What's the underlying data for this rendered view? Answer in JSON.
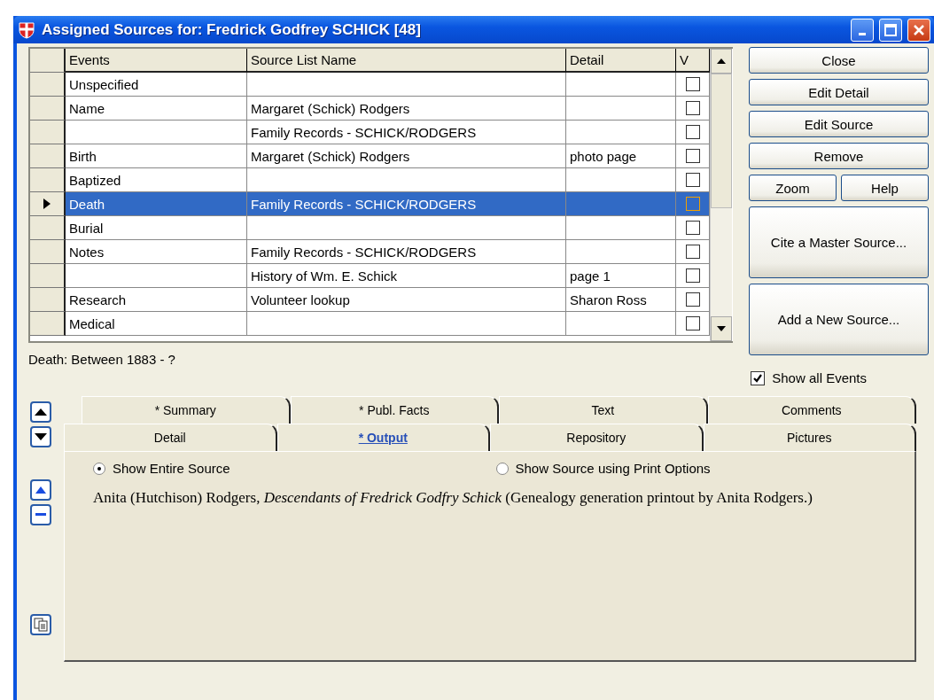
{
  "window": {
    "title": "Assigned Sources for: Fredrick Godfrey SCHICK [48]"
  },
  "table": {
    "columns": [
      "Events",
      "Source List Name",
      "Detail",
      "V"
    ],
    "rows": [
      {
        "event": "Unspecified",
        "selected": false,
        "checked": false
      },
      {
        "event": "Name",
        "source": "Margaret (Schick) Rodgers",
        "selected": false,
        "checked": false
      },
      {
        "source": "Family Records - SCHICK/RODGERS",
        "selected": false,
        "checked": false
      },
      {
        "event": "Birth",
        "source": "Margaret (Schick) Rodgers",
        "detail": "photo page",
        "selected": false,
        "checked": false
      },
      {
        "event": "Baptized",
        "selected": false,
        "checked": false
      },
      {
        "event": "Death",
        "source": "Family Records - SCHICK/RODGERS",
        "selected": true,
        "checked": false
      },
      {
        "event": "Burial",
        "selected": false,
        "checked": false
      },
      {
        "event": "Notes",
        "source": "Family Records - SCHICK/RODGERS",
        "selected": false,
        "checked": false
      },
      {
        "source": "History of Wm. E. Schick",
        "detail": "page 1",
        "selected": false,
        "checked": false
      },
      {
        "event": "Research",
        "source": "Volunteer lookup",
        "detail": "Sharon Ross",
        "selected": false,
        "checked": false
      },
      {
        "event": "Medical",
        "selected": false,
        "checked": false
      }
    ]
  },
  "buttons": [
    {
      "label": "Close",
      "kind": "wide"
    },
    {
      "label": "Edit Detail",
      "kind": "wide"
    },
    {
      "label": "Edit Source",
      "kind": "wide"
    },
    {
      "label": "Remove",
      "kind": "wide"
    },
    {
      "label": "Zoom",
      "kind": "pair"
    },
    {
      "label": "Help",
      "kind": "pair"
    },
    {
      "label": "Cite a Master Source...",
      "kind": "tall"
    },
    {
      "label": "Add a New Source...",
      "kind": "tall"
    }
  ],
  "status": "Death: Between 1883 - ?",
  "show_all_events": {
    "label": "Show all Events",
    "checked": true
  },
  "tabs_back": [
    {
      "label": "* Summary",
      "selected": false
    },
    {
      "label": "* Publ. Facts",
      "selected": false
    },
    {
      "label": "Text",
      "selected": false
    },
    {
      "label": "Comments",
      "selected": false
    }
  ],
  "tabs_front": [
    {
      "label": "Detail",
      "selected": false
    },
    {
      "label": "* Output",
      "selected": true
    },
    {
      "label": "Repository",
      "selected": false
    },
    {
      "label": "Pictures",
      "selected": false
    }
  ],
  "options": [
    {
      "label": "Show Entire Source",
      "selected": true
    },
    {
      "label": "Show Source using Print Options",
      "selected": false
    }
  ],
  "citation": "Anita (Hutchison) Rodgers, *Descendants of Fredrick Godfry Schick* (Genealogy generation printout by Anita Rodgers.)"
}
